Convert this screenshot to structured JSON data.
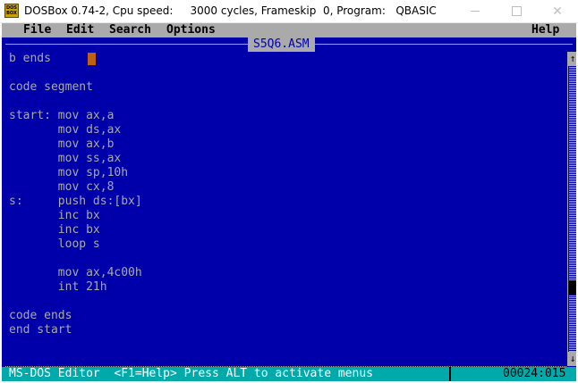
{
  "window": {
    "title": "DOSBox 0.74-2, Cpu speed:     3000 cycles, Frameskip  0, Program:   QBASIC",
    "icon_text": "DOS BOX",
    "minimize_icon": "minimize-icon",
    "maximize_icon": "maximize-icon",
    "close_icon": "close-icon",
    "close_glyph": "✕"
  },
  "menu": {
    "items": [
      "File",
      "Edit",
      "Search",
      "Options"
    ],
    "help": "Help"
  },
  "editor": {
    "filename": "S5Q6.ASM",
    "lines": [
      "b ends",
      "",
      "code segment",
      "",
      "start: mov ax,a",
      "       mov ds,ax",
      "       mov ax,b",
      "       mov ss,ax",
      "       mov sp,10h",
      "       mov cx,8",
      "s:     push ds:[bx]",
      "       inc bx",
      "       inc bx",
      "       loop s",
      "",
      "       mov ax,4c00h",
      "       int 21h",
      "",
      "code ends",
      "end start"
    ],
    "scroll_up": "↑",
    "scroll_down": "↓"
  },
  "status": {
    "text": "MS-DOS Editor  <F1=Help> Press ALT to activate menus",
    "position": "00024:015"
  },
  "colors": {
    "dos_blue": "#0000aa",
    "dos_gray": "#aaaaaa",
    "status_cyan": "#00aaaa",
    "cursor": "#c06010"
  }
}
